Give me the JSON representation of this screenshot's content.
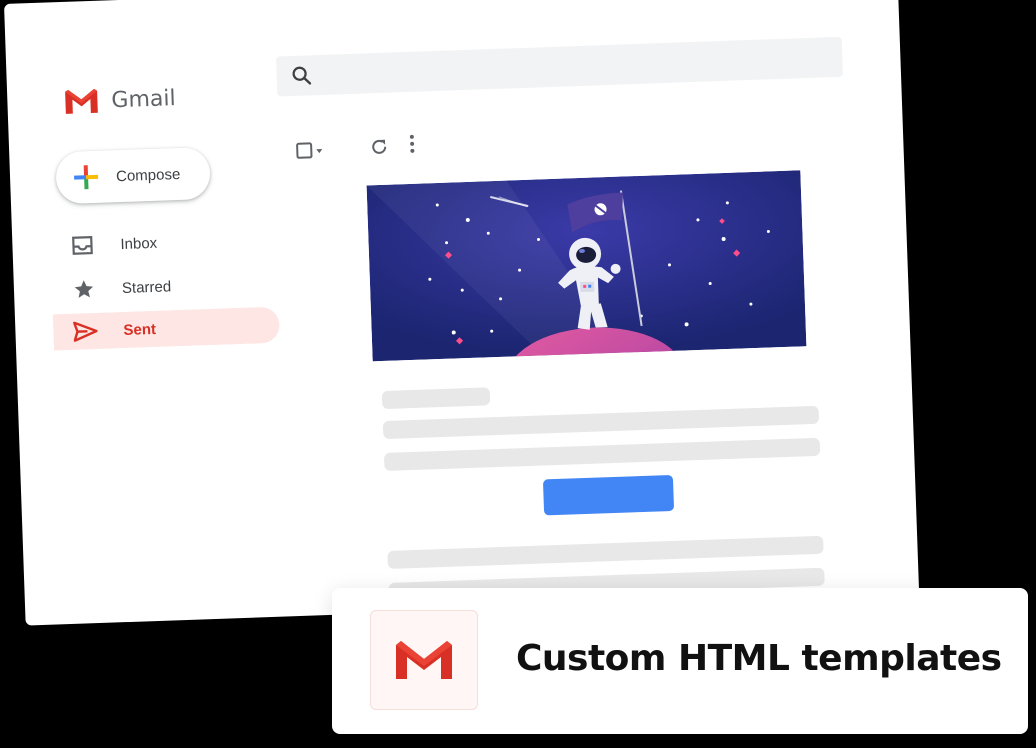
{
  "app": {
    "name": "Gmail"
  },
  "compose": {
    "label": "Compose"
  },
  "sidebar": {
    "items": [
      {
        "label": "Inbox",
        "icon": "inbox-icon"
      },
      {
        "label": "Starred",
        "icon": "star-icon"
      },
      {
        "label": "Sent",
        "icon": "send-icon",
        "active": true
      }
    ]
  },
  "search": {
    "placeholder": ""
  },
  "toolbar": {
    "icons": [
      "select-checkbox-icon",
      "refresh-icon",
      "more-vert-icon"
    ]
  },
  "card": {
    "title": "Custom HTML templates"
  },
  "colors": {
    "gmail_red": "#d93025",
    "cta_blue": "#4285f4",
    "banner_bg": "#1f2a7a",
    "active_bg": "#fde6e4"
  }
}
